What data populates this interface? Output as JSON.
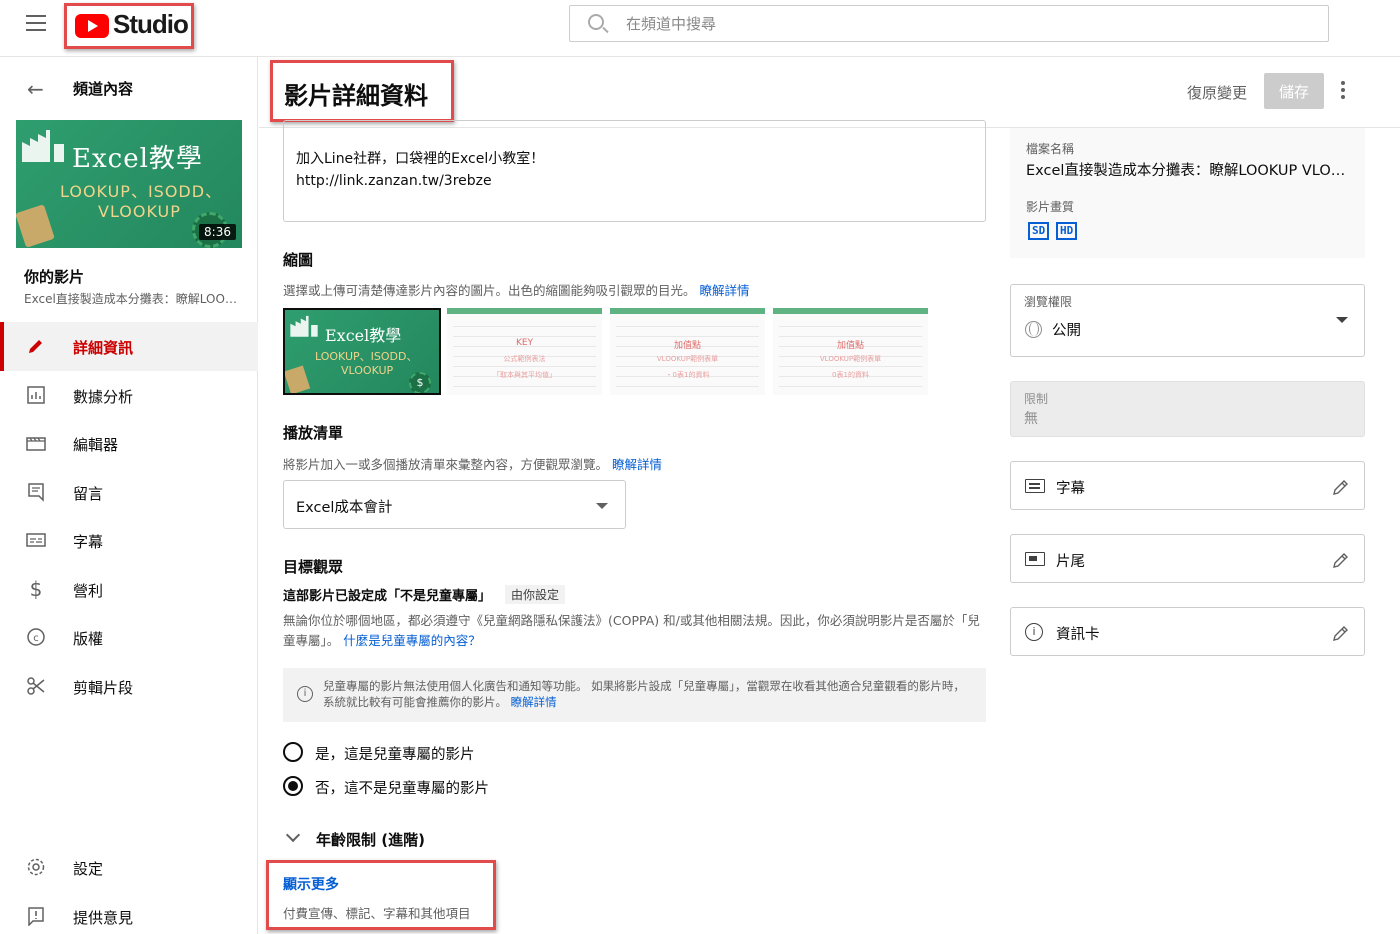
{
  "topbar": {
    "logo_text": "Studio",
    "search_placeholder": "在頻道中搜尋"
  },
  "sidebar": {
    "back_label": "頻道內容",
    "thumbnail": {
      "title": "Excel教學",
      "line1": "LOOKUP、ISODD、",
      "line2": "VLOOKUP",
      "duration": "8:36"
    },
    "your_video_label": "你的影片",
    "video_name": "Excel直接製造成本分攤表：瞭解LOOKUP VLOOKUP",
    "items": [
      {
        "label": "詳細資訊",
        "icon": "pencil-icon",
        "active": true
      },
      {
        "label": "數據分析",
        "icon": "analytics-icon",
        "active": false
      },
      {
        "label": "編輯器",
        "icon": "clapperboard-icon",
        "active": false
      },
      {
        "label": "留言",
        "icon": "comment-icon",
        "active": false
      },
      {
        "label": "字幕",
        "icon": "subtitles-icon",
        "active": false
      },
      {
        "label": "營利",
        "icon": "dollar-icon",
        "active": false
      },
      {
        "label": "版權",
        "icon": "copyright-icon",
        "active": false
      },
      {
        "label": "剪輯片段",
        "icon": "scissors-icon",
        "active": false
      }
    ],
    "bottom_items": [
      {
        "label": "設定",
        "icon": "gear-icon"
      },
      {
        "label": "提供意見",
        "icon": "feedback-icon"
      }
    ]
  },
  "header": {
    "title": "影片詳細資料",
    "undo_label": "復原變更",
    "save_label": "儲存"
  },
  "description": {
    "line1": "加入Line社群，口袋裡的Excel小教室！",
    "line2": "http://link.zanzan.tw/3rebze"
  },
  "thumbnail_section": {
    "title": "縮圖",
    "help": "選擇或上傳可清楚傳達影片內容的圖片。出色的縮圖能夠吸引觀眾的目光。",
    "learn_more": "瞭解詳情",
    "selected": {
      "title": "Excel教學",
      "line1": "LOOKUP、ISODD、",
      "line2": "VLOOKUP",
      "coin": "$"
    },
    "options": [
      {
        "t1": "KEY",
        "t2": "公式範例表法",
        "t3": "「取本與其平均值」"
      },
      {
        "t1": "加值點",
        "t2": "VLOOKUP範例表單",
        "t3": "・0表1的資料"
      },
      {
        "t1": "加值點",
        "t2": "VLOOKUP範例表單",
        "t3": "0表1的資料"
      }
    ]
  },
  "playlist": {
    "title": "播放清單",
    "help": "將影片加入一或多個播放清單來彙整內容，方便觀眾瀏覽。",
    "learn_more": "瞭解詳情",
    "value": "Excel成本會計"
  },
  "audience": {
    "title": "目標觀眾",
    "status": "這部影片已設定成「不是兒童專屬」",
    "set_by": "由你設定",
    "coppa_text": "無論你位於哪個地區，都必須遵守《兒童網路隱私保護法》(COPPA) 和/或其他相關法規。因此，你必須說明影片是否屬於「兒童專屬」。",
    "coppa_link": "什麼是兒童專屬的內容？",
    "notice_text": "兒童專屬的影片無法使用個人化廣告和通知等功能。 如果將影片設成「兒童專屬」，當觀眾在收看其他適合兒童觀看的影片時，系統就比較有可能會推薦你的影片。",
    "notice_link": "瞭解詳情",
    "option_yes": "是，這是兒童專屬的影片",
    "option_no": "否，這不是兒童專屬的影片",
    "selected": "no"
  },
  "age_restriction": {
    "label": "年齡限制 (進階)"
  },
  "show_more": {
    "label": "顯示更多",
    "sub": "付費宣傳、標記、字幕和其他項目"
  },
  "right_panel": {
    "filename_label": "檔案名稱",
    "filename": "Excel直接製造成本分攤表：瞭解LOOKUP VLOOKUP",
    "quality_label": "影片畫質",
    "quality_badges": [
      "SD",
      "HD"
    ],
    "visibility_label": "瀏覽權限",
    "visibility_value": "公開",
    "restriction_label": "限制",
    "restriction_value": "無",
    "cards": [
      {
        "label": "字幕",
        "icon": "subtitles-icon"
      },
      {
        "label": "片尾",
        "icon": "end-screen-icon"
      },
      {
        "label": "資訊卡",
        "icon": "info-icon"
      }
    ]
  }
}
